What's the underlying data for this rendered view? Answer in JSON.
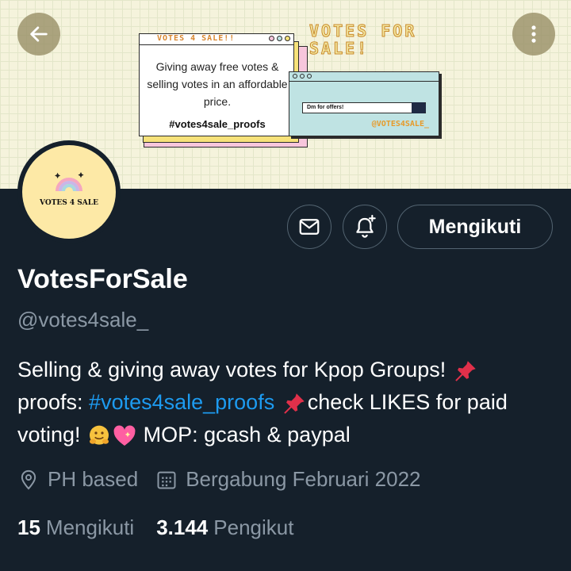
{
  "banner": {
    "headline_line1": "VOTES FOR",
    "headline_line2": "SALE!",
    "main_window_title": "VOTES 4 SALE!!",
    "main_window_text": "Giving away free votes & selling votes in an affordable price.",
    "main_window_tag": "#votes4sale_proofs",
    "small_window_input": "Dm for offers!",
    "small_window_handle": "@VOTES4SALE_"
  },
  "avatar": {
    "label": "VOTES 4 SALE"
  },
  "actions": {
    "follow_label": "Mengikuti",
    "message_icon": "mail-icon",
    "notify_icon": "bell-plus-icon"
  },
  "profile": {
    "name": "VotesForSale",
    "handle": "@votes4sale_",
    "bio": {
      "part1": "Selling & giving away votes for Kpop Groups!",
      "part2": "proofs: ",
      "link": "#votes4sale_proofs",
      "part3": "check LIKES for paid voting!",
      "part4": "MOP: gcash & paypal"
    },
    "location": "PH based",
    "joined": "Bergabung Februari 2022"
  },
  "stats": {
    "following_count": "15",
    "following_label": "Mengikuti",
    "followers_count": "3.144",
    "followers_label": "Pengikut"
  },
  "colors": {
    "background": "#15202b",
    "link": "#1d9bf0",
    "secondary_text": "#8b98a5"
  }
}
